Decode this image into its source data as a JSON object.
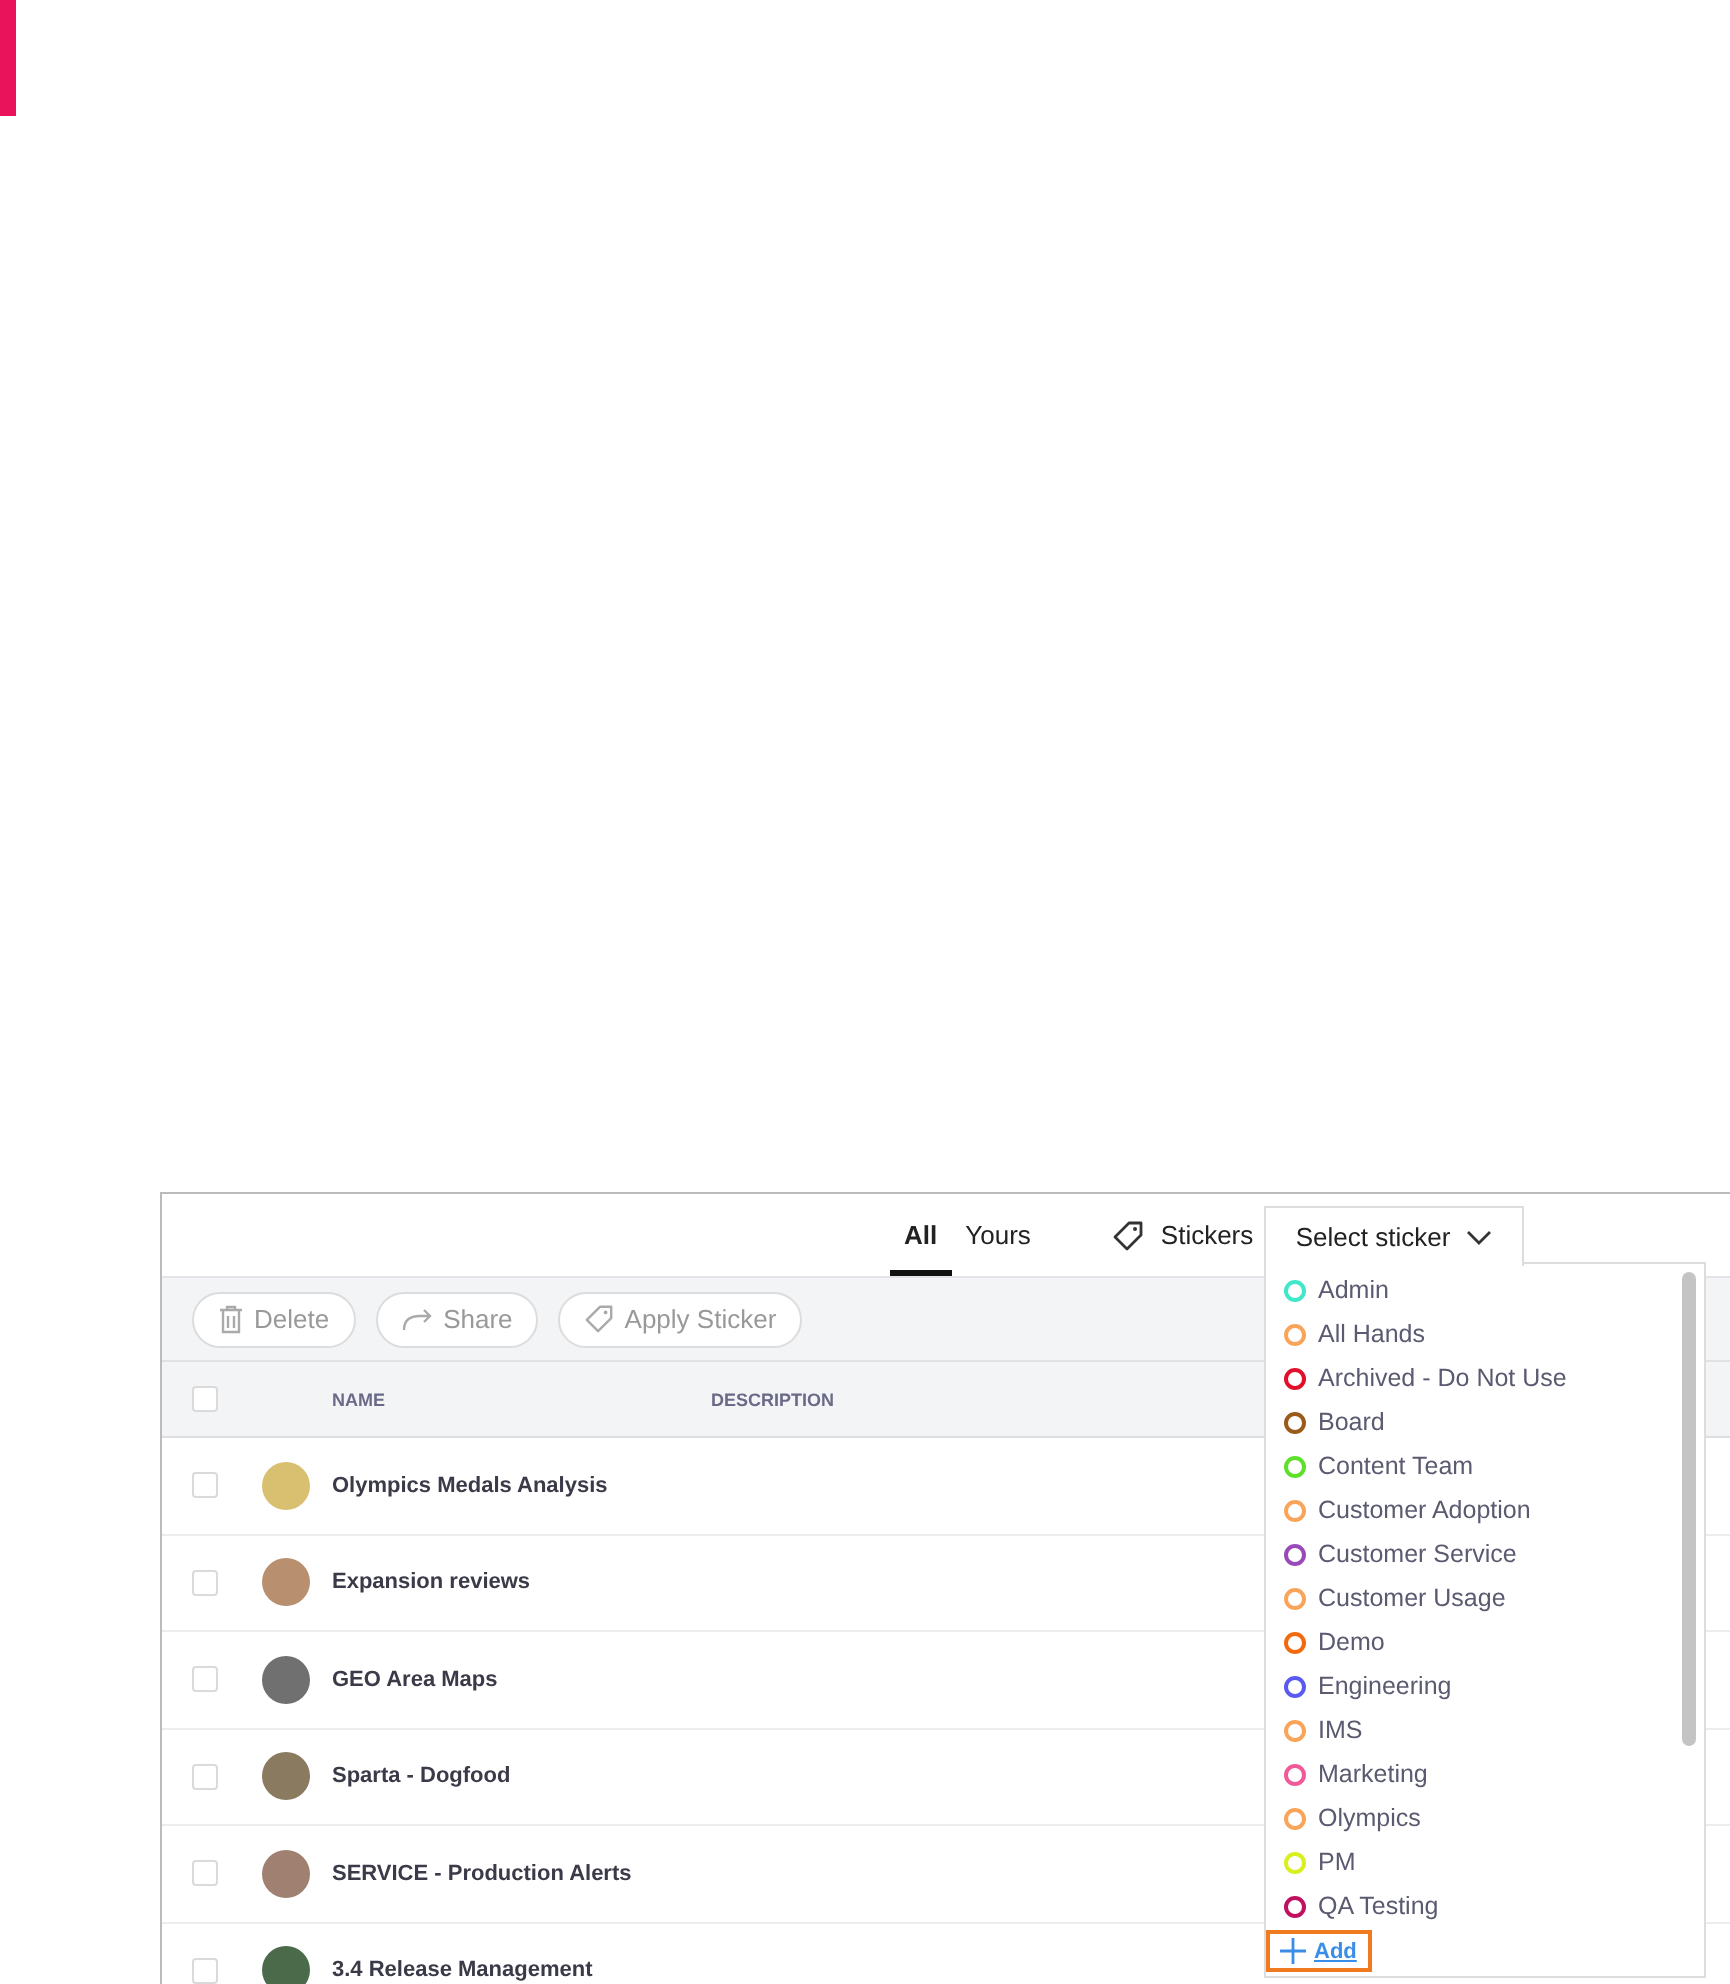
{
  "tabs": [
    {
      "label": "All",
      "selected": true
    },
    {
      "label": "Yours",
      "selected": false
    }
  ],
  "stickers_label": "Stickers",
  "sticker_select": {
    "label": "Select sticker",
    "expanded": true,
    "options": [
      {
        "label": "Admin",
        "color": "#3ee8c8"
      },
      {
        "label": "All Hands",
        "color": "#f8a55a"
      },
      {
        "label": "Archived - Do Not Use",
        "color": "#e0102a"
      },
      {
        "label": "Board",
        "color": "#9a5a1a"
      },
      {
        "label": "Content Team",
        "color": "#5ee02a"
      },
      {
        "label": "Customer Adoption",
        "color": "#f8a55a"
      },
      {
        "label": "Customer Service",
        "color": "#9a4ab8"
      },
      {
        "label": "Customer Usage",
        "color": "#f8a55a"
      },
      {
        "label": "Demo",
        "color": "#f26a10"
      },
      {
        "label": "Engineering",
        "color": "#5a5af0"
      },
      {
        "label": "IMS",
        "color": "#f8a55a"
      },
      {
        "label": "Marketing",
        "color": "#f05a9a"
      },
      {
        "label": "Olympics",
        "color": "#f8a55a"
      },
      {
        "label": "PM",
        "color": "#d8f020"
      },
      {
        "label": "QA Testing",
        "color": "#c01060"
      }
    ],
    "add_label": "Add"
  },
  "actions": [
    {
      "kind": "delete",
      "label": "Delete"
    },
    {
      "kind": "share",
      "label": "Share"
    },
    {
      "kind": "sticker",
      "label": "Apply Sticker"
    }
  ],
  "table": {
    "all_checked": false,
    "columns": [
      "NAME",
      "DESCRIPTION"
    ],
    "rows": [
      {
        "name": "Olympics Medals Analysis",
        "checked": false
      },
      {
        "name": "Expansion reviews",
        "checked": false
      },
      {
        "name": "GEO Area Maps",
        "checked": false
      },
      {
        "name": "Sparta - Dogfood",
        "checked": false
      },
      {
        "name": "SERVICE - Production Alerts",
        "checked": false
      },
      {
        "name": "3.4 Release Management",
        "checked": false
      }
    ]
  }
}
